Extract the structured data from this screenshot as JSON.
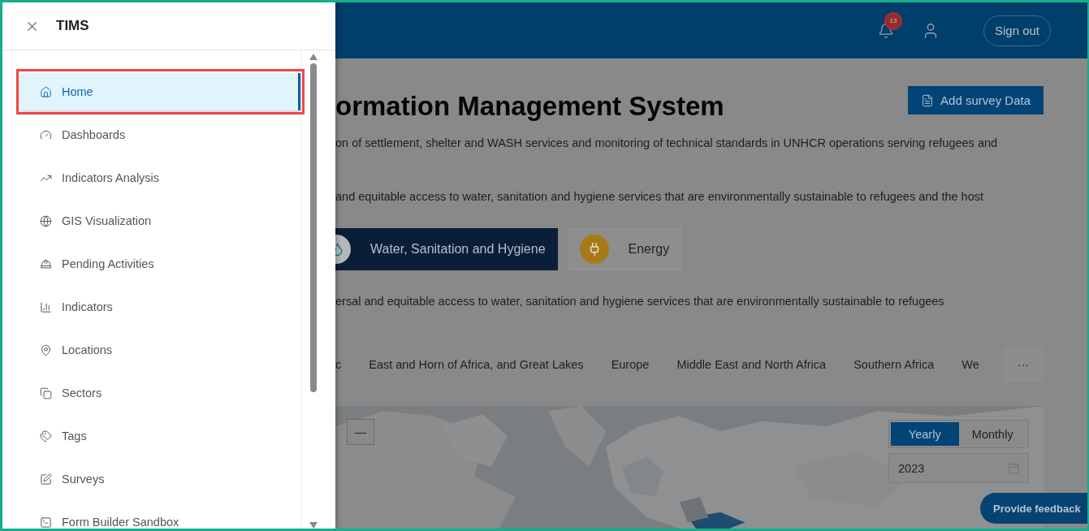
{
  "drawer": {
    "title": "TIMS",
    "items": [
      {
        "label": "Home",
        "selected": true
      },
      {
        "label": "Dashboards",
        "selected": false
      },
      {
        "label": "Indicators Analysis",
        "selected": false
      },
      {
        "label": "GIS Visualization",
        "selected": false
      },
      {
        "label": "Pending Activities",
        "selected": false
      },
      {
        "label": "Indicators",
        "selected": false
      },
      {
        "label": "Locations",
        "selected": false
      },
      {
        "label": "Sectors",
        "selected": false
      },
      {
        "label": "Tags",
        "selected": false
      },
      {
        "label": "Surveys",
        "selected": false
      },
      {
        "label": "Form Builder Sandbox",
        "selected": false
      }
    ]
  },
  "header": {
    "notification_count": "13",
    "sign_out": "Sign out"
  },
  "page": {
    "title": "ormation Management System",
    "add_button": "Add survey Data",
    "intro": "on of settlement, shelter and WASH services and monitoring of technical standards in UNHCR operations serving refugees and",
    "goal": "and equitable access to water, sanitation and hygiene services that are environmentally sustainable to refugees and the host",
    "sectors": [
      {
        "label": "Water, Sanitation and Hygiene",
        "selected": true
      },
      {
        "label": "Energy",
        "selected": false
      }
    ],
    "sector_text": "ersal and equitable access to water, sanitation and hygiene services that are environmentally sustainable to refugees",
    "regions": [
      "c",
      "East and Horn of Africa, and Great Lakes",
      "Europe",
      "Middle East and North Africa",
      "Southern Africa",
      "We"
    ],
    "more": "···",
    "map": {
      "kind": "picture",
      "zoom_out": "—",
      "periods": [
        {
          "label": "Yearly",
          "selected": true
        },
        {
          "label": "Monthly",
          "selected": false
        }
      ],
      "year": "2023"
    }
  },
  "feedback": "Provide feedback"
}
